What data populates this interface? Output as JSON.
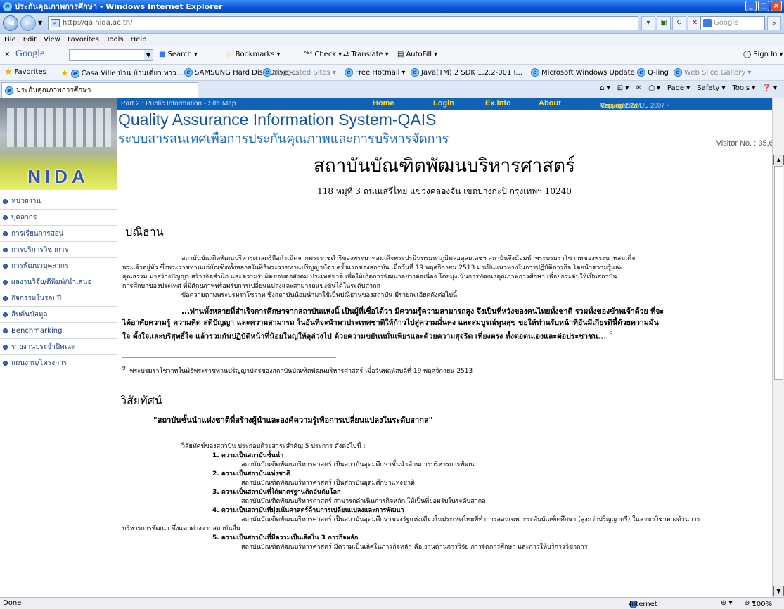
{
  "window": {
    "title": "ประกันคุณภาพการศึกษา - Windows Internet Explorer",
    "url": "http://qa.nida.ac.th/",
    "search_placeholder": "Google"
  },
  "menu": [
    "File",
    "Edit",
    "View",
    "Favorites",
    "Tools",
    "Help"
  ],
  "google_toolbar": {
    "brand": "Google",
    "search": "Search",
    "bookmarks": "Bookmarks",
    "check": "Check",
    "translate": "Translate",
    "autofill": "AutoFill",
    "signin": "Sign In"
  },
  "favorites": {
    "label": "Favorites",
    "items": [
      "Casa Ville บ้าน บ้านเดี่ยว ทาว...",
      "SAMSUNG Hard Disk Drive -...",
      "Suggested Sites",
      "Free Hotmail",
      "Java(TM) 2 SDK 1.2.2-001 I...",
      "Microsoft Windows Update",
      "Q-ling",
      "Web Slice Gallery"
    ]
  },
  "tab": {
    "title": "ประกันคุณภาพการศึกษา"
  },
  "command_bar": {
    "page": "Page",
    "safety": "Safety",
    "tools": "Tools"
  },
  "site": {
    "part": "Part 2 : Public Information - Site Map",
    "nav": [
      "Home",
      "Login",
      "Ex.info",
      "About"
    ],
    "copyright": "Copyright © MJU 2007 - ",
    "version": "Version 2.2a",
    "logo_text": "NIDA",
    "title": "Quality Assurance Information System-QAIS",
    "subtitle": "ระบบสารสนเทศเพื่อการประกันคุณภาพและการบริหารจัดการ",
    "visitor": "Visitor No. : 35,622"
  },
  "sidebar": [
    "หน่วยงาน",
    "บุคลากร",
    "การเรียนการสอน",
    "การบริการวิชาการ",
    "การพัฒนาบุคลากร",
    "ผลงานวิจัย/ตีพิมพ์/นำเสนอ",
    "กิจกรรมในรอบปี",
    "สืบค้นข้อมูล",
    "Benchmarking",
    "รายงานประจำปีคณะ",
    "แผนงาน/โครงการ"
  ],
  "content": {
    "title": "สถาบันบัณฑิตพัฒนบริหารศาสตร์",
    "address": "118 หมู่ที่ 3 ถนนเสรีไทย แขวงคลองจั่น เขตบางกะปิ   กรุงเทพฯ 10240",
    "h_pledge": "ปณิธาน",
    "pledge_l1": "สถาบันบัณฑิตพัฒนบริหารศาสตร์ถือกำเนิดจากพระราชดำริของพระบาทสมเด็จพระปรมินทรมหาภูมิพลอดุลยเดชฯ สถาบันจึงน้อมนำพระบรมราโชวาทของพระบาทสมเด็จ",
    "pledge_l2": "พระเจ้าอยู่หัว ซึ่งพระราชทานแก่บัณฑิตทั้งหลายในพิธีพระราชทานปริญญาบัตร ครั้งแรกของสถาบัน เมื่อวันที่ 19  พฤศจิกายน 2513  มาเป็นแนวทางในการปฏิบัติภารกิจ โดยนำความรู้และ",
    "pledge_l3": "คุณธรรม มาสร้างปัญญา สร้างจิตสำนึก และความรับผิดชอบต่อสังคม ประเทศชาติ เพื่อให้เกิดการพัฒนาอย่างต่อเนื่อง โดยมุ่งเน้นการพัฒนาคุณภาพการศึกษา เพื่อยกระดับให้เป็นสถาบัน",
    "pledge_l4": "การศึกษาของประเทศ ที่มีศักยภาพพร้อมรับการเปลี่ยนแปลงและสามารถแข่งขันได้ในระดับสากล",
    "pledge_l5": "ข้อความตามพระบรมราโชวาท ซึ่งสถาบันน้อมนำมาใช้เป็นปณิธานของสถาบัน มีรายละเอียดดังต่อไปนี้",
    "quote_l1": "...ท่านทั้งหลายที่สำเร็จการศึกษาจากสถาบันแห่งนี้ เป็นผู้ที่เชื่อได้ว่า มีความรู้ความสามารถสูง จึงเป็นที่หวังของคนไทยทั้งชาติ รวมทั้งของข้าพเจ้าด้วย ที่จะ",
    "quote_l2": "ได้อาศัยความรู้ ความคิด สติปัญญา และความสามารถ ในอันที่จะนำพาประเทศชาติให้ก้าวไปสู่ความมั่นคง และสมบูรณ์พูนสุข  ขอให้ท่านรับหน้าที่อันมีเกียรตินี้ด้วยความมั่น",
    "quote_l3": "ใจ ตั้งใจและบริสุทธิ์ใจ แล้วร่วมกันปฏิบัติหน้าที่น้อยใหญ่ให้ลุล่วงไป ด้วยความขยันหมั่นเพียรและด้วยความสุจริต เที่ยงตรง ทั้งต่อตนเองและต่อประชาชน...",
    "fn_mark": "9",
    "footnote": "พระบรมราโชวาทในพิธีพระราชทานปริญญาบัตรของสถาบันบัณฑิตพัฒนบริหารศาสตร์ เมื่อวันพฤหัสบดีที่ 19 พฤศจิกายน 2513",
    "h_vision": "วิสัยทัศน์",
    "vision": "\"สถาบันชั้นนำแห่งชาติที่สร้างผู้นำและองค์ความรู้เพื่อการเปลี่ยนแปลงในระดับสากล\"",
    "vision_intro": "วิสัยทัศน์ของสถาบัน ประกอบด้วยสาระสำคัญ 5 ประการ ดังต่อไปนี้ :",
    "v1_h": "1. ความเป็นสถาบันชั้นนำ",
    "v1_t": "สถาบันบัณฑิตพัฒนบริหารศาสตร์ เป็นสถาบันอุดมศึกษาชั้นนำด้านการบริหารการพัฒนา",
    "v2_h": "2. ความเป็นสถาบันแห่งชาติ",
    "v2_t": "สถาบันบัณฑิตพัฒนบริหารศาสตร์ เป็นสถาบันอุดมศึกษาแห่งชาติ",
    "v3_h": "3. ความเป็นสถาบันที่ได้มาตรฐานติดอันดับโลก",
    "v3_t": "สถาบันบัณฑิตพัฒนบริหารศาสตร์ สามารถดำเนินภารกิจหลัก ให้เป็นที่ยอมรับในระดับสากล",
    "v4_h": "4. ความเป็นสถาบันที่มุ่งเน้นศาสตร์ด้านการเปลี่ยนแปลงและการพัฒนา",
    "v4_t1": "สถาบันบัณฑิตพัฒนบริหารศาสตร์ เป็นสถาบันอุดมศึกษาของรัฐแห่งเดียวในประเทศไทยที่ทำการสอนเฉพาะระดับบัณฑิตศึกษา (สูงกว่าปริญญาตรี) ในสาขาวิชาทางด้านการ",
    "v4_t2": "บริหารการพัฒนา ซึ่งแตกต่างจากสถาบันอื่น",
    "v5_h": "5. ความเป็นสถาบันที่มีความเป็นเลิศใน 3 ภารกิจหลัก",
    "v5_t": "สถาบันบัณฑิตพัฒนบริหารศาสตร์ มีความเป็นเลิศในภารกิจหลัก คือ งานด้านการวิจัย การจัดการศึกษา และการให้บริการวิชาการ"
  },
  "status": {
    "left": "Done",
    "zone": "Internet",
    "zoom": "100%"
  }
}
